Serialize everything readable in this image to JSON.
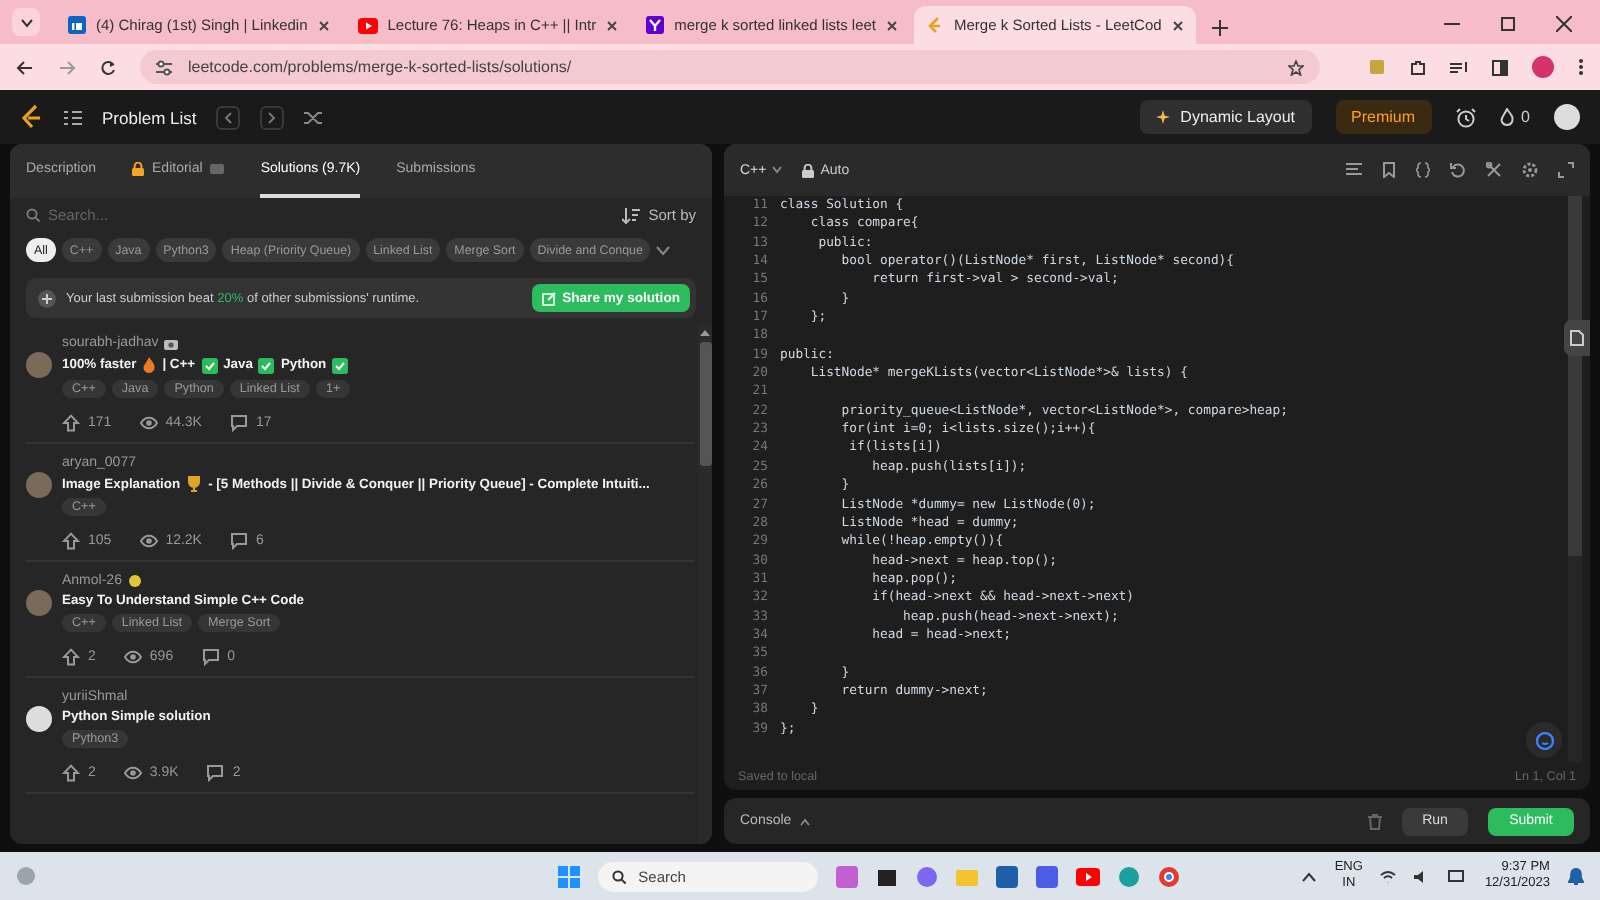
{
  "browser": {
    "tabs": [
      {
        "title": "(4) Chirag (1st) Singh | Linkedin",
        "selected": false
      },
      {
        "title": "Lecture 76: Heaps in C++ || Intr",
        "selected": false
      },
      {
        "title": "merge k sorted linked lists leet",
        "selected": false
      },
      {
        "title": "Merge k Sorted Lists - LeetCod",
        "selected": true
      }
    ],
    "url": "leetcode.com/problems/merge-k-sorted-lists/solutions/"
  },
  "header": {
    "problem_list": "Problem List",
    "layout_button": "Dynamic Layout",
    "premium": "Premium",
    "streak": "0"
  },
  "left_panel": {
    "tabs": [
      {
        "label": "Description",
        "locked": false,
        "selected": false
      },
      {
        "label": "Editorial",
        "locked": true,
        "selected": false
      },
      {
        "label": "Solutions (9.7K)",
        "locked": false,
        "selected": true
      },
      {
        "label": "Submissions",
        "locked": false,
        "selected": false
      }
    ],
    "search": {
      "placeholder": "Search..."
    },
    "sort": "Sort by",
    "chips": [
      {
        "label": "All",
        "selected": true
      },
      {
        "label": "C++",
        "selected": false
      },
      {
        "label": "Java",
        "selected": false
      },
      {
        "label": "Python3",
        "selected": false
      },
      {
        "label": "Heap (Priority Queue)",
        "selected": false
      },
      {
        "label": "Linked List",
        "selected": false
      },
      {
        "label": "Merge Sort",
        "selected": false
      },
      {
        "label": "Divide and Conque",
        "selected": false
      }
    ],
    "banner": {
      "text": "Your last submission beat **20%** of other submissions' runtime.",
      "button": "Share my solution"
    },
    "solutions": [
      {
        "author": "sourabh-jadhav",
        "title_parts": [
          "100% faster",
          "| C++",
          "Java",
          "Python"
        ],
        "tags": [
          "C++",
          "Java",
          "Python",
          "Linked List",
          "1+"
        ],
        "upvotes": "171",
        "views": "44.3K",
        "comments": "17"
      },
      {
        "author": "aryan_0077",
        "title_parts": [
          "Image Explanation",
          "- [5 Methods || Divide & Conquer || Priority Queue] - Complete Intuiti..."
        ],
        "tags": [
          "C++"
        ],
        "upvotes": "105",
        "views": "12.2K",
        "comments": "6"
      },
      {
        "author": "Anmol-26",
        "title_parts": [
          "Easy To Understand Simple C++ Code"
        ],
        "tags": [
          "C++",
          "Linked List",
          "Merge Sort"
        ],
        "upvotes": "2",
        "views": "696",
        "comments": "0"
      },
      {
        "author": "yuriiShmal",
        "title_parts": [
          "Python Simple solution"
        ],
        "tags": [
          "Python3"
        ],
        "upvotes": "2",
        "views": "3.9K",
        "comments": "2"
      }
    ]
  },
  "editor": {
    "language": "C++",
    "mode": "Auto",
    "lines": [
      {
        "number": "11",
        "text": "class Solution {"
      },
      {
        "number": "12",
        "text": "    class compare{"
      },
      {
        "number": "13",
        "text": "     public:"
      },
      {
        "number": "14",
        "text": "        bool operator()(ListNode* first, ListNode* second){"
      },
      {
        "number": "15",
        "text": "            return first->val > second->val;"
      },
      {
        "number": "16",
        "text": "        }"
      },
      {
        "number": "17",
        "text": "    };"
      },
      {
        "number": "18"
      },
      {
        "number": "19",
        "text": "public:"
      },
      {
        "number": "20",
        "text": "    ListNode* mergeKLists(vector<ListNode*>& lists) {"
      },
      {
        "number": "21"
      },
      {
        "number": "22",
        "text": "        priority_queue<ListNode*, vector<ListNode*>, compare>heap;"
      },
      {
        "number": "23",
        "text": "        for(int i=0; i<lists.size();i++){"
      },
      {
        "number": "24",
        "text": "         if(lists[i])"
      },
      {
        "number": "25",
        "text": "            heap.push(lists[i]);"
      },
      {
        "number": "26",
        "text": "        }"
      },
      {
        "number": "27",
        "text": "        ListNode *dummy= new ListNode(0);"
      },
      {
        "number": "28",
        "text": "        ListNode *head = dummy;"
      },
      {
        "number": "29",
        "text": "        while(!heap.empty()){"
      },
      {
        "number": "30",
        "text": "            head->next = heap.top();"
      },
      {
        "number": "31",
        "text": "            heap.pop();"
      },
      {
        "number": "32",
        "text": "            if(head->next && head->next->next)"
      },
      {
        "number": "33",
        "text": "                heap.push(head->next->next);"
      },
      {
        "number": "34",
        "text": "            head = head->next;"
      },
      {
        "number": "35"
      },
      {
        "number": "36",
        "text": "        }"
      },
      {
        "number": "37",
        "text": "        return dummy->next;"
      },
      {
        "number": "38",
        "text": "    }"
      },
      {
        "number": "39",
        "text": "};"
      }
    ],
    "status": "Saved to local",
    "cursor": "Ln 1, Col 1"
  },
  "console": {
    "label": "Console",
    "run": "Run",
    "submit": "Submit"
  },
  "taskbar": {
    "search": "Search",
    "language": "ENG",
    "region": "IN",
    "time": "9:37 PM",
    "date": "12/31/2023"
  }
}
